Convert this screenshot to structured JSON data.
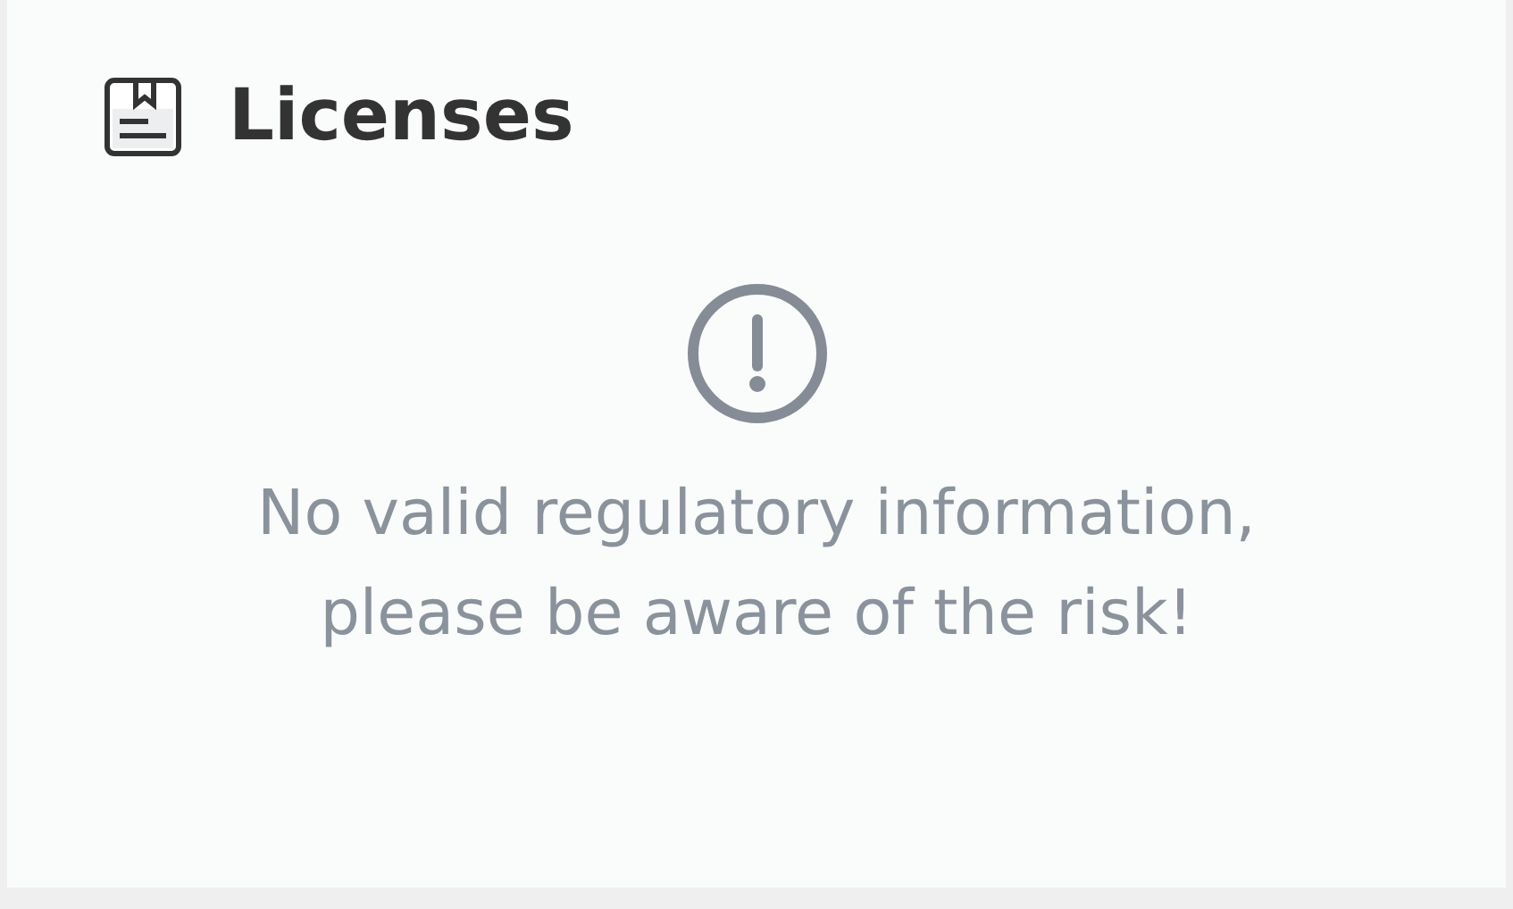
{
  "card": {
    "title": "Licenses",
    "notice": {
      "lines": [
        "No valid regulatory information,",
        "please be aware of the risk!"
      ]
    }
  }
}
